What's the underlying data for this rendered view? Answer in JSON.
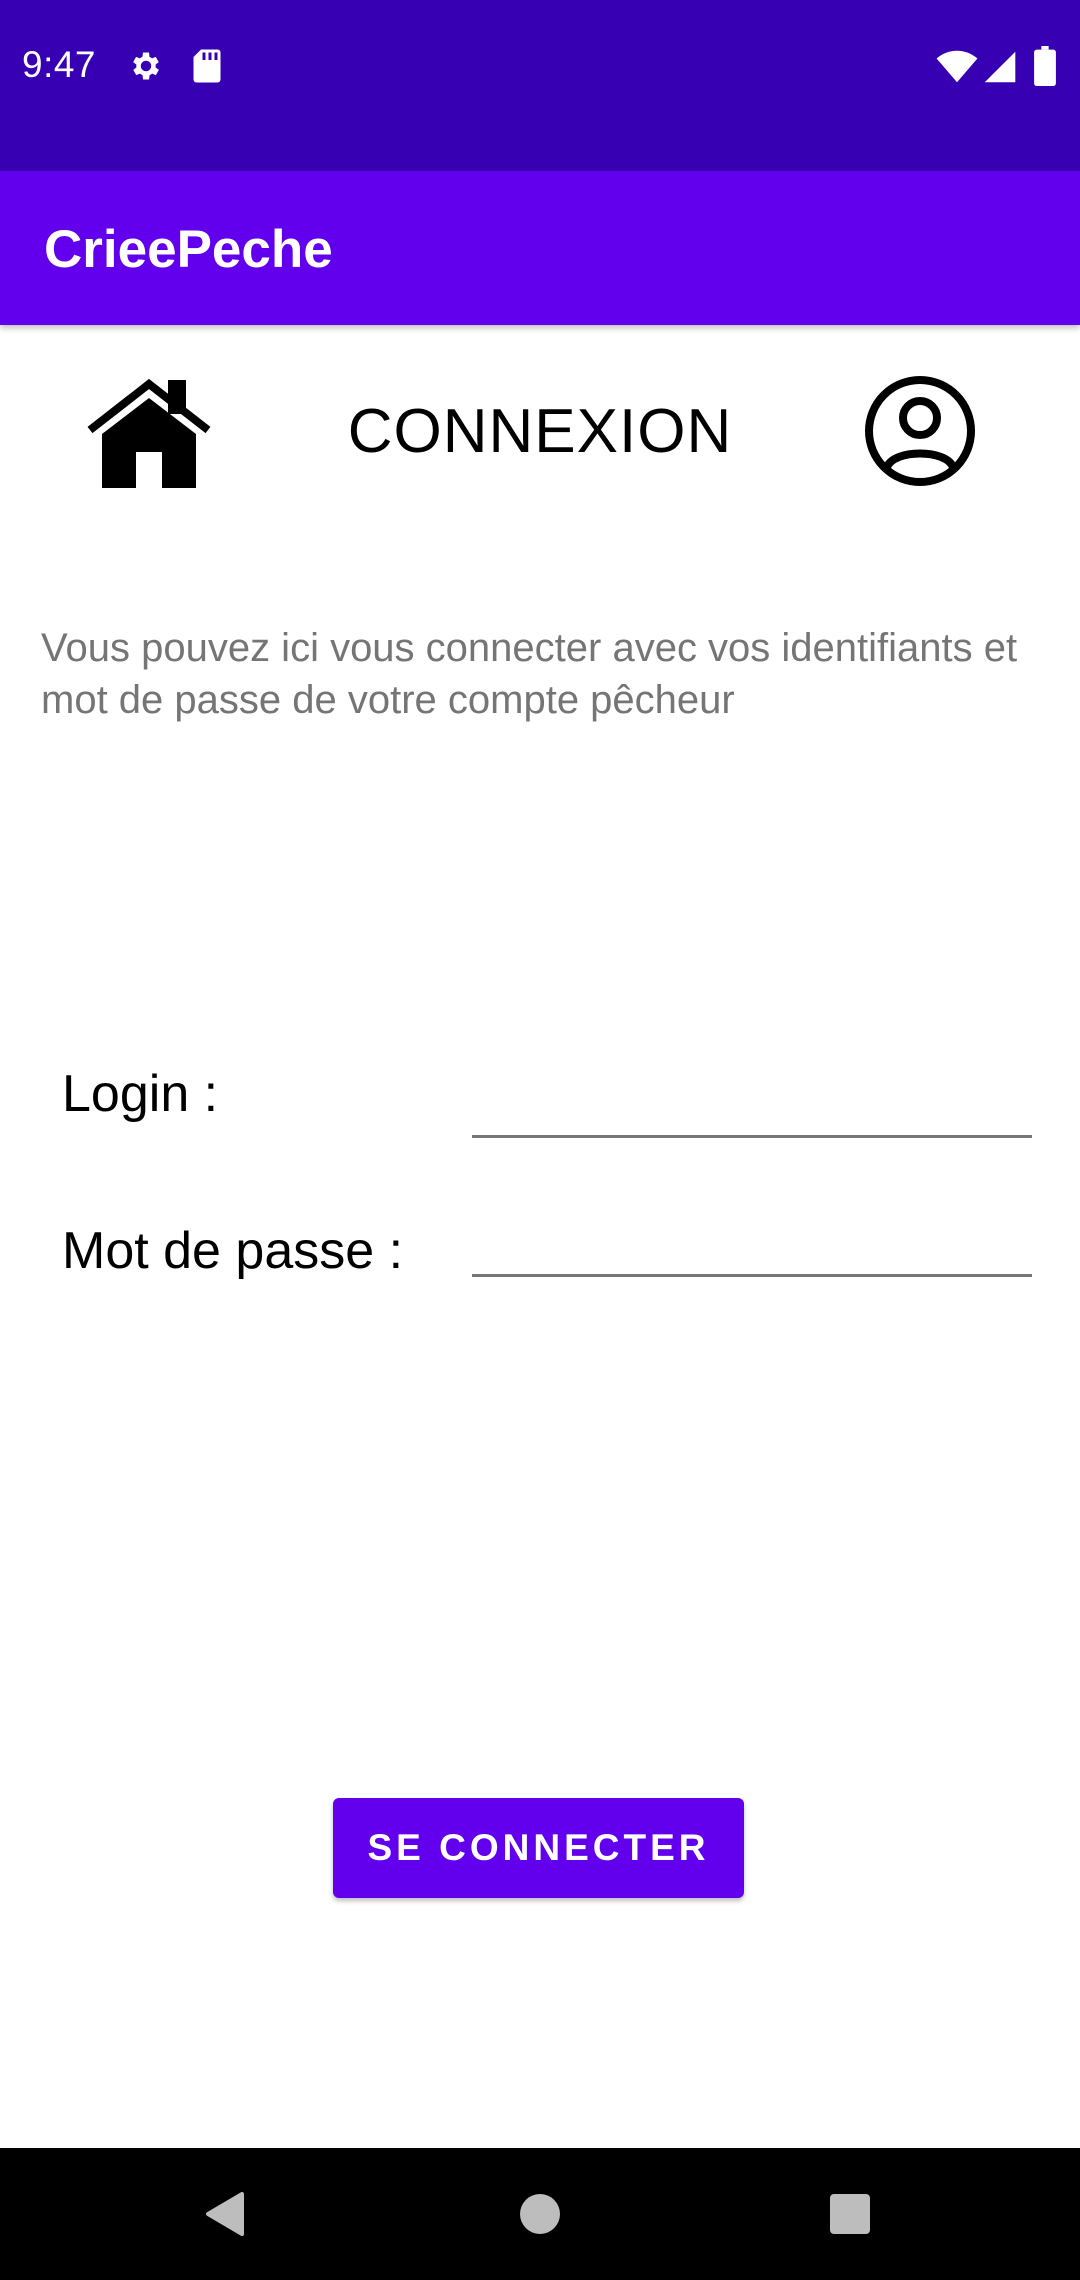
{
  "status_bar": {
    "time": "9:47",
    "icons": [
      "settings-icon",
      "sd-card-icon",
      "wifi-icon",
      "signal-icon",
      "battery-icon"
    ]
  },
  "app_bar": {
    "title": "CrieePeche"
  },
  "header": {
    "title": "CONNEXION",
    "left_icon": "home-icon",
    "right_icon": "account-circle-icon"
  },
  "description": "Vous pouvez ici vous connecter avec vos identifiants et mot de passe de votre compte pêcheur",
  "form": {
    "login_label": "Login :",
    "login_value": "",
    "password_label": "Mot de passe :",
    "password_value": "",
    "submit_label": "SE CONNECTER"
  },
  "nav_bar": {
    "buttons": [
      "back-icon",
      "home-circle-icon",
      "recents-icon"
    ]
  },
  "colors": {
    "status_bar": "#3700b3",
    "app_bar": "#6200ee",
    "button": "#6200ee",
    "description_text": "#757575"
  }
}
